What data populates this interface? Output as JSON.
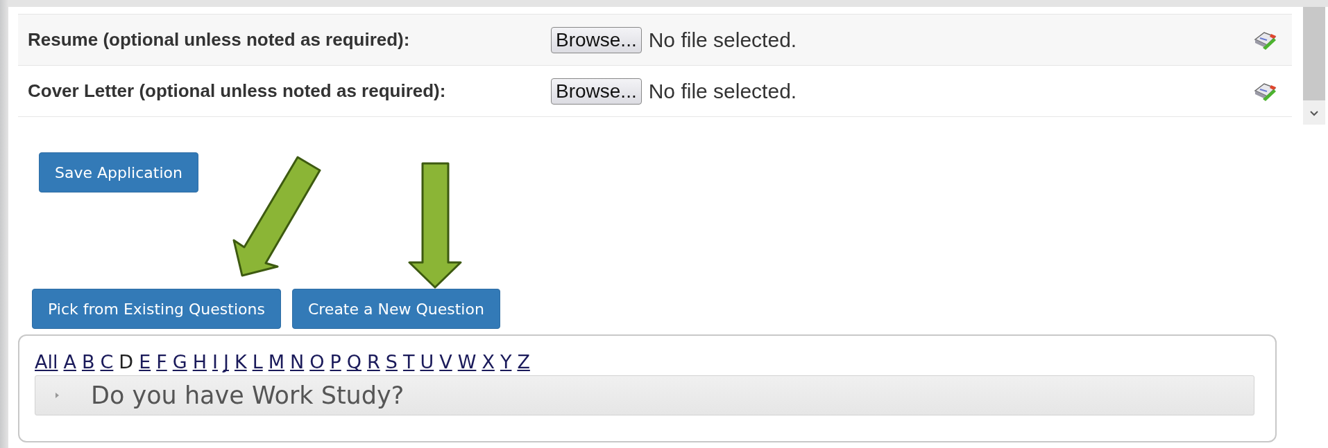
{
  "uploads": [
    {
      "label": "Resume (optional unless noted as required):",
      "button": "Browse...",
      "status": "No file selected."
    },
    {
      "label": "Cover Letter (optional unless noted as required):",
      "button": "Browse...",
      "status": "No file selected."
    }
  ],
  "save_button": "Save Application",
  "question_buttons": [
    "Pick from Existing Questions",
    "Create a New Question"
  ],
  "letters": [
    {
      "label": "All",
      "link": true
    },
    {
      "label": "A",
      "link": true
    },
    {
      "label": "B",
      "link": true
    },
    {
      "label": "C",
      "link": true
    },
    {
      "label": "D",
      "link": false
    },
    {
      "label": "E",
      "link": true
    },
    {
      "label": "F",
      "link": true
    },
    {
      "label": "G",
      "link": true
    },
    {
      "label": "H",
      "link": true
    },
    {
      "label": "I",
      "link": true
    },
    {
      "label": "J",
      "link": true
    },
    {
      "label": "K",
      "link": true
    },
    {
      "label": "L",
      "link": true
    },
    {
      "label": "M",
      "link": true
    },
    {
      "label": "N",
      "link": true
    },
    {
      "label": "O",
      "link": true
    },
    {
      "label": "P",
      "link": true
    },
    {
      "label": "Q",
      "link": true
    },
    {
      "label": "R",
      "link": true
    },
    {
      "label": "S",
      "link": true
    },
    {
      "label": "T",
      "link": true
    },
    {
      "label": "U",
      "link": true
    },
    {
      "label": "V",
      "link": true
    },
    {
      "label": "W",
      "link": true
    },
    {
      "label": "X",
      "link": true
    },
    {
      "label": "Y",
      "link": true
    },
    {
      "label": "Z",
      "link": true
    }
  ],
  "questions": [
    {
      "text": "Do you have Work Study?",
      "expanded": false
    }
  ]
}
